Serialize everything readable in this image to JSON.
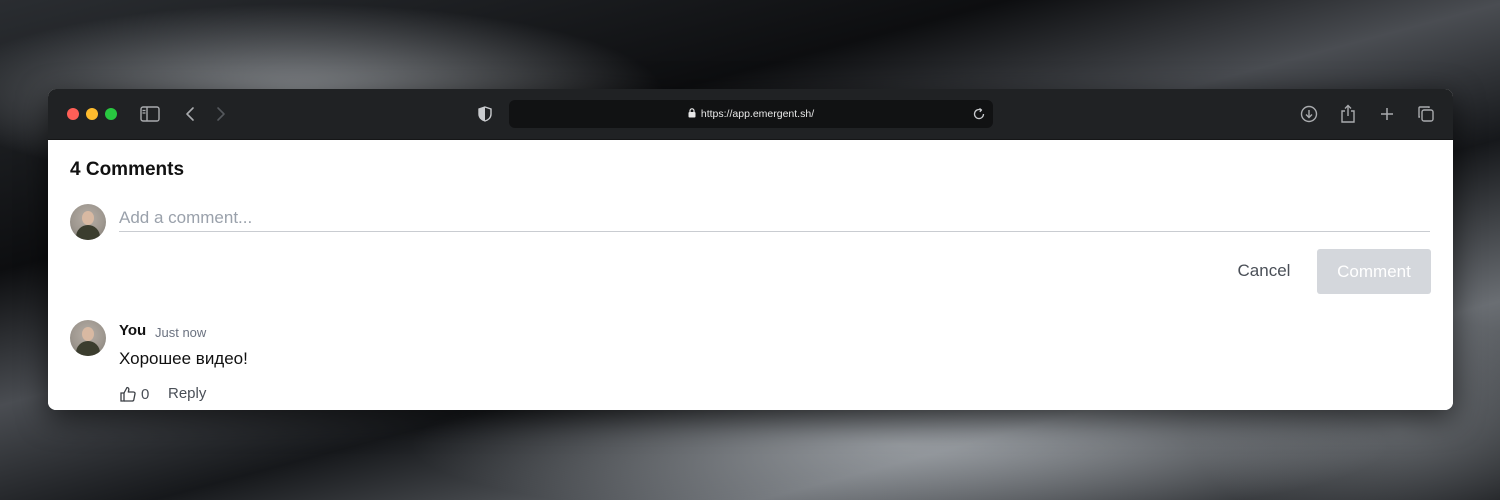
{
  "browser": {
    "url": "https://app.emergent.sh/"
  },
  "comments_section": {
    "heading": "4 Comments",
    "input_placeholder": "Add a comment...",
    "cancel_label": "Cancel",
    "submit_label": "Comment"
  },
  "comments": [
    {
      "author": "You",
      "time": "Just now",
      "text": "Хорошее видео!",
      "likes": "0",
      "reply_label": "Reply"
    }
  ]
}
